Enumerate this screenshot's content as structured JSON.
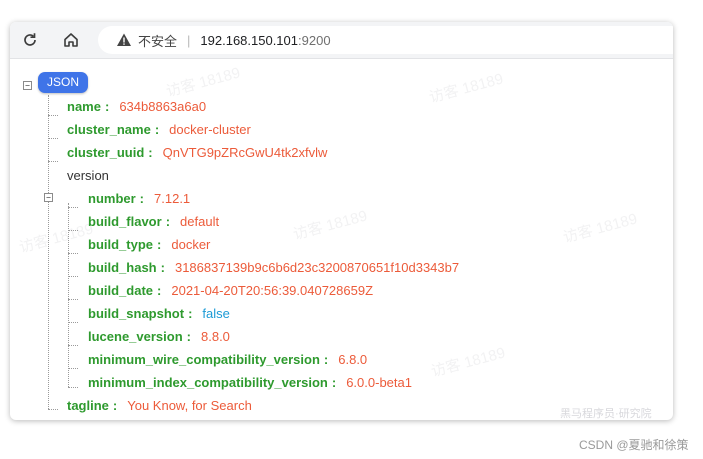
{
  "browser": {
    "security_label": "不安全",
    "address_host": "192.168.150.101",
    "address_port": ":9200"
  },
  "json_viewer": {
    "root_badge": "JSON",
    "name": {
      "key": "name",
      "value": "634b8863a6a0"
    },
    "cluster_name": {
      "key": "cluster_name",
      "value": "docker-cluster"
    },
    "cluster_uuid": {
      "key": "cluster_uuid",
      "value": "QnVTG9pZRcGwU4tk2xfvlw"
    },
    "version": {
      "label": "version",
      "number": {
        "key": "number",
        "value": "7.12.1"
      },
      "build_flavor": {
        "key": "build_flavor",
        "value": "default"
      },
      "build_type": {
        "key": "build_type",
        "value": "docker"
      },
      "build_hash": {
        "key": "build_hash",
        "value": "3186837139b9c6b6d23c3200870651f10d3343b7"
      },
      "build_date": {
        "key": "build_date",
        "value": "2021-04-20T20:56:39.040728659Z"
      },
      "build_snapshot": {
        "key": "build_snapshot",
        "value": "false"
      },
      "lucene_version": {
        "key": "lucene_version",
        "value": "8.8.0"
      },
      "minimum_wire_compatibility_version": {
        "key": "minimum_wire_compatibility_version",
        "value": "6.8.0"
      },
      "minimum_index_compatibility_version": {
        "key": "minimum_index_compatibility_version",
        "value": "6.0.0-beta1"
      }
    },
    "tagline": {
      "key": "tagline",
      "value": "You Know, for Search"
    }
  },
  "watermark_text": "访客 18189",
  "site_mark": "黑马程序员·研究院",
  "credit": "CSDN @夏驰和徐策",
  "icons": {
    "reload": "reload-icon",
    "home": "home-icon",
    "warning": "warning-icon",
    "collapse": "collapse-minus-icon"
  }
}
